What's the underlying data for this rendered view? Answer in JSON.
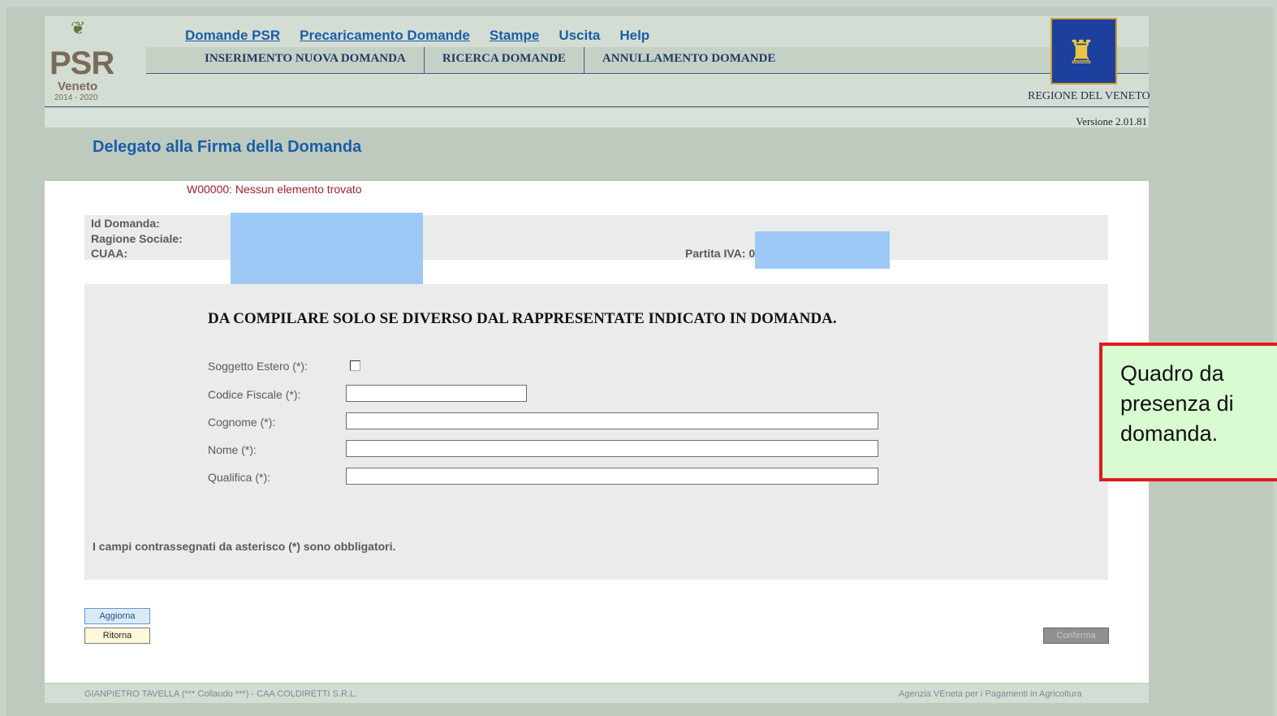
{
  "logo": {
    "text": "PSR",
    "region": "Veneto",
    "years": "2014 - 2020"
  },
  "topnav": [
    "Domande PSR",
    "Precaricamento Domande",
    "Stampe",
    "Uscita",
    "Help"
  ],
  "subnav": [
    "INSERIMENTO NUOVA DOMANDA",
    "RICERCA DOMANDE",
    "ANNULLAMENTO DOMANDE"
  ],
  "header": {
    "regione": "REGIONE DEL VENETO",
    "versione": "Versione 2.01.81"
  },
  "page": {
    "title": "Delegato alla Firma della Domanda",
    "warning": "W00000: Nessun elemento trovato"
  },
  "info": {
    "id_domanda": "Id Domanda:",
    "ragione_sociale": "Ragione Sociale:",
    "cuaa": "CUAA:",
    "partita_iva": "Partita IVA: 0"
  },
  "form": {
    "heading": "DA COMPILARE SOLO SE DIVERSO DAL RAPPRESENTATE INDICATO IN DOMANDA.",
    "soggetto_estero": "Soggetto Estero (*):",
    "codice_fiscale": "Codice Fiscale (*):",
    "cognome": "Cognome (*):",
    "nome": "Nome (*):",
    "qualifica": "Qualifica (*):",
    "values": {
      "codice_fiscale": "",
      "cognome": "",
      "nome": "",
      "qualifica": ""
    },
    "soggetto_estero_checked": false
  },
  "note": "I campi contrassegnati da asterisco (*) sono obbligatori.",
  "buttons": {
    "aggiorna": "Aggiorna",
    "ritorna": "Ritorna",
    "conferma": "Conferma"
  },
  "footer": {
    "left": "GIANPIETRO TAVELLA (*** Collaudo ***) - CAA COLDIRETTI S.R.L.",
    "right": "Agenzia VEneta per i Pagamenti in Agricoltura"
  },
  "callout": {
    "text": "Quadro da\npresenza di\ndomanda."
  }
}
